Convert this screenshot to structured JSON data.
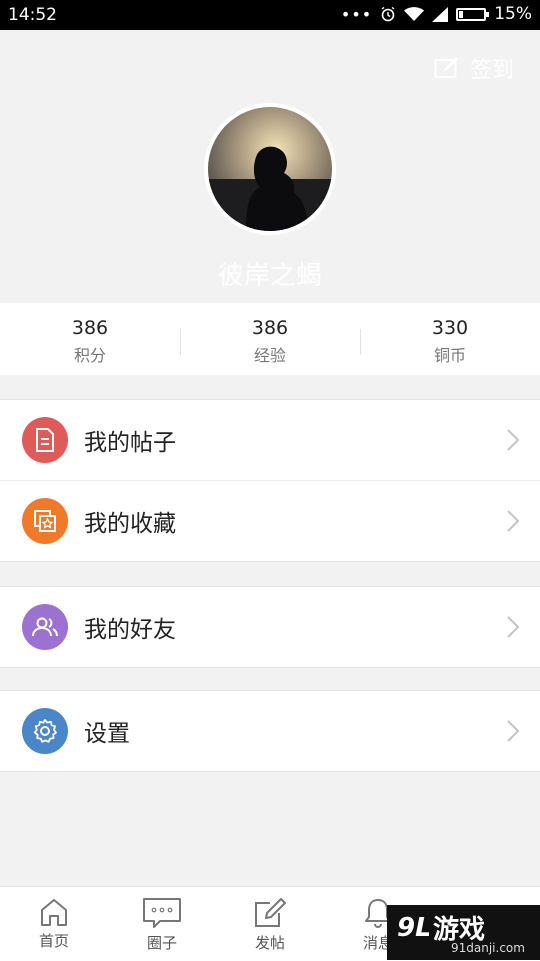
{
  "status_bar": {
    "time": "14:52",
    "battery": "15%",
    "battery_level": 0.15
  },
  "header": {
    "checkin_label": "签到",
    "username": "彼岸之蝎"
  },
  "stats": [
    {
      "value": "386",
      "label": "积分"
    },
    {
      "value": "386",
      "label": "经验"
    },
    {
      "value": "330",
      "label": "铜币"
    }
  ],
  "menu": {
    "posts": "我的帖子",
    "favorites": "我的收藏",
    "friends": "我的好友",
    "settings": "设置"
  },
  "tabs": [
    {
      "label": "首页",
      "icon": "home-icon"
    },
    {
      "label": "圈子",
      "icon": "chat-bubble-icon"
    },
    {
      "label": "发帖",
      "icon": "compose-icon"
    },
    {
      "label": "消息",
      "icon": "bell-icon"
    }
  ],
  "watermark": {
    "main": "游戏",
    "sub": "91danji.com",
    "logo": "9L"
  },
  "colors": {
    "posts_icon": "#e05a5a",
    "favorites_icon": "#f07a2a",
    "friends_icon": "#9b72d0",
    "settings_icon": "#4a86c8"
  }
}
